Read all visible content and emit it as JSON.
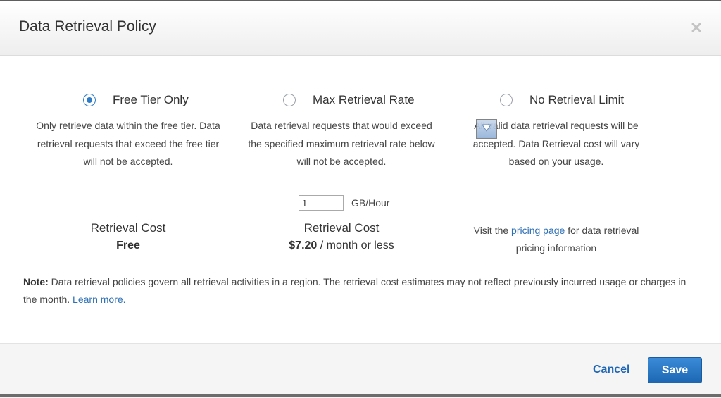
{
  "dialog": {
    "title": "Data Retrieval Policy"
  },
  "options": [
    {
      "label": "Free Tier Only",
      "selected": true,
      "description": "Only retrieve data within the free tier. Data retrieval requests that exceed the free tier will not be accepted."
    },
    {
      "label": "Max Retrieval Rate",
      "selected": false,
      "description": "Data retrieval requests that would exceed the specified maximum retrieval rate below will not be accepted."
    },
    {
      "label": "No Retrieval Limit",
      "selected": false,
      "description": "All valid data retrieval requests will be accepted. Data Retrieval cost will vary based on your usage."
    }
  ],
  "rate": {
    "value": "1",
    "unit": "GB/Hour"
  },
  "costs": {
    "free_tier": {
      "label": "Retrieval Cost",
      "value": "Free"
    },
    "max_rate": {
      "label": "Retrieval Cost",
      "amount": "$7.20",
      "suffix": " / month or less"
    },
    "no_limit": {
      "prefix": "Visit the ",
      "link": "pricing page",
      "suffix": " for data retrieval pricing information"
    }
  },
  "note": {
    "label": "Note:",
    "text": " Data retrieval policies govern all retrieval activities in a region. The retrieval cost estimates may not reflect previously incurred usage or charges in the month. ",
    "link": "Learn more."
  },
  "footer": {
    "cancel_label": "Cancel",
    "save_label": "Save"
  },
  "colors": {
    "accent": "#2e7cc7",
    "link": "#2e70b6",
    "save_button": "#1d67b3"
  },
  "icons": {
    "close": "close-icon",
    "radio_selected": "radio-checked-icon",
    "radio_empty": "radio-empty-icon",
    "drag": "drag-arrow-icon"
  }
}
